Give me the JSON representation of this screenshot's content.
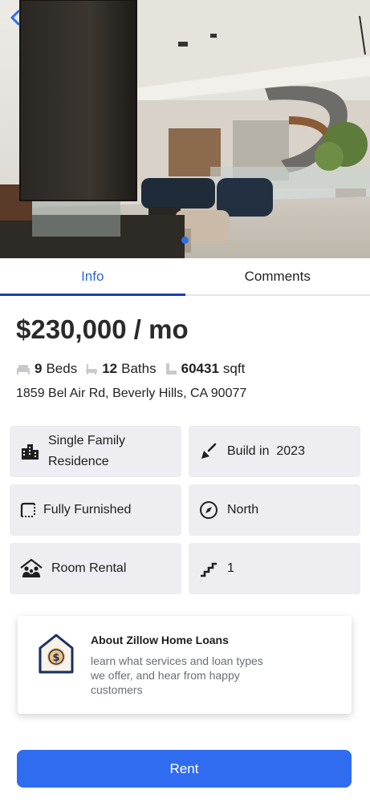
{
  "tabs": [
    {
      "label": "Info",
      "active": true
    },
    {
      "label": "Comments",
      "active": false
    }
  ],
  "listing": {
    "price": "$230,000 / mo",
    "beds_count": "9",
    "beds_label": "Beds",
    "baths_count": "12",
    "baths_label": "Baths",
    "area_value": "60431",
    "area_unit": "sqft",
    "address": "1859 Bel Air Rd, Beverly Hills, CA 90077"
  },
  "features": [
    {
      "icon": "building-icon",
      "label": "Single Family Residence"
    },
    {
      "icon": "trowel-icon",
      "label": "Build in  2023"
    },
    {
      "icon": "floor-plan-icon",
      "label": "Fully Furnished"
    },
    {
      "icon": "compass-icon",
      "label": "North"
    },
    {
      "icon": "family-home-icon",
      "label": "Room Rental"
    },
    {
      "icon": "stairs-icon",
      "label": "1"
    }
  ],
  "loan_card": {
    "title": "About Zillow Home Loans",
    "description": "learn what services and loan types we offer, and hear from happy customers"
  },
  "actions": {
    "rent_label": "Rent"
  },
  "carousel": {
    "current_index": 1
  },
  "colors": {
    "accent": "#2f6cef",
    "tab_active": "#2e66d6",
    "feature_bg": "#ededf2"
  }
}
